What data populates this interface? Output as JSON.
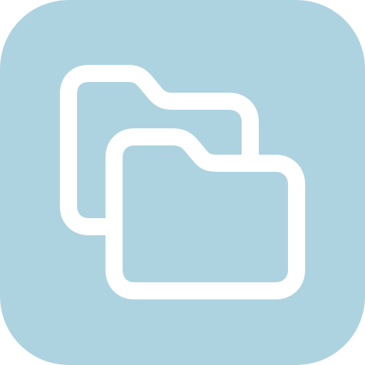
{
  "app_icon": {
    "icon": "folders-icon",
    "background_color": "#aed3e0",
    "glyph_color": "#ffffff"
  }
}
